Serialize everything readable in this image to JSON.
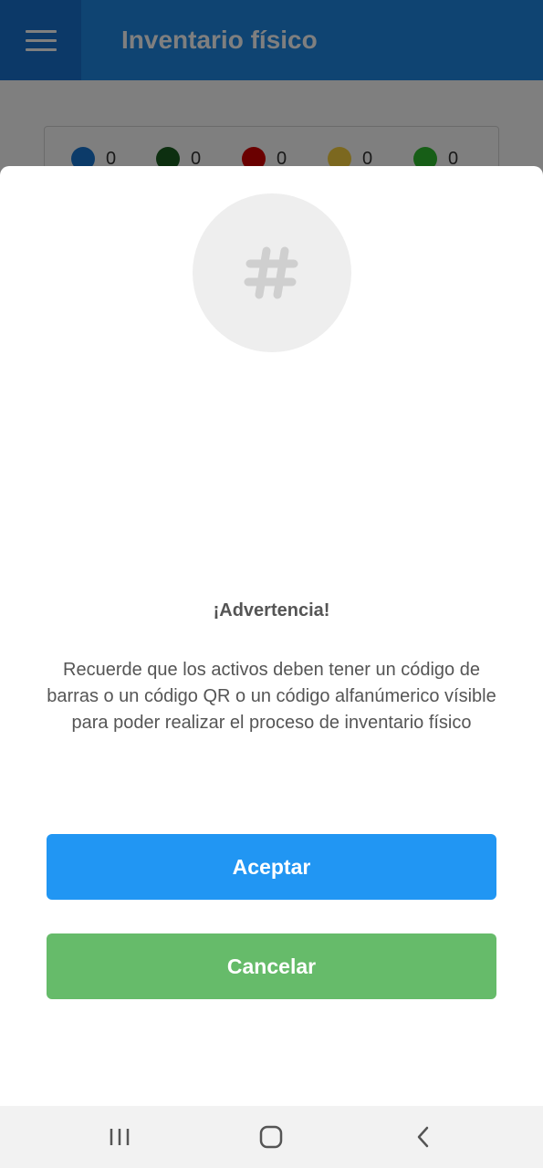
{
  "app_bar": {
    "title": "Inventario físico",
    "menu_icon": "hamburger-menu-icon"
  },
  "legend": {
    "items": [
      {
        "color": "#1976d2",
        "count": "0"
      },
      {
        "color": "#1b5e20",
        "count": "0"
      },
      {
        "color": "#d50000",
        "count": "0"
      },
      {
        "color": "#f9d13e",
        "count": "0"
      },
      {
        "color": "#2ebd2e",
        "count": "0"
      }
    ]
  },
  "dialog": {
    "icon": "hashtag-icon",
    "title": "¡Advertencia!",
    "message": "Recuerde que los activos deben tener un código de barras o un código QR o un código alfanúmerico vísible para poder realizar el proceso de inventario físico",
    "accept_label": "Aceptar",
    "cancel_label": "Cancelar"
  },
  "colors": {
    "app_bar": "#1e88e5",
    "accept": "#2196f3",
    "cancel": "#66bb6a"
  },
  "system_nav": {
    "recents_icon": "recent-apps-icon",
    "home_icon": "home-icon",
    "back_icon": "back-icon"
  }
}
